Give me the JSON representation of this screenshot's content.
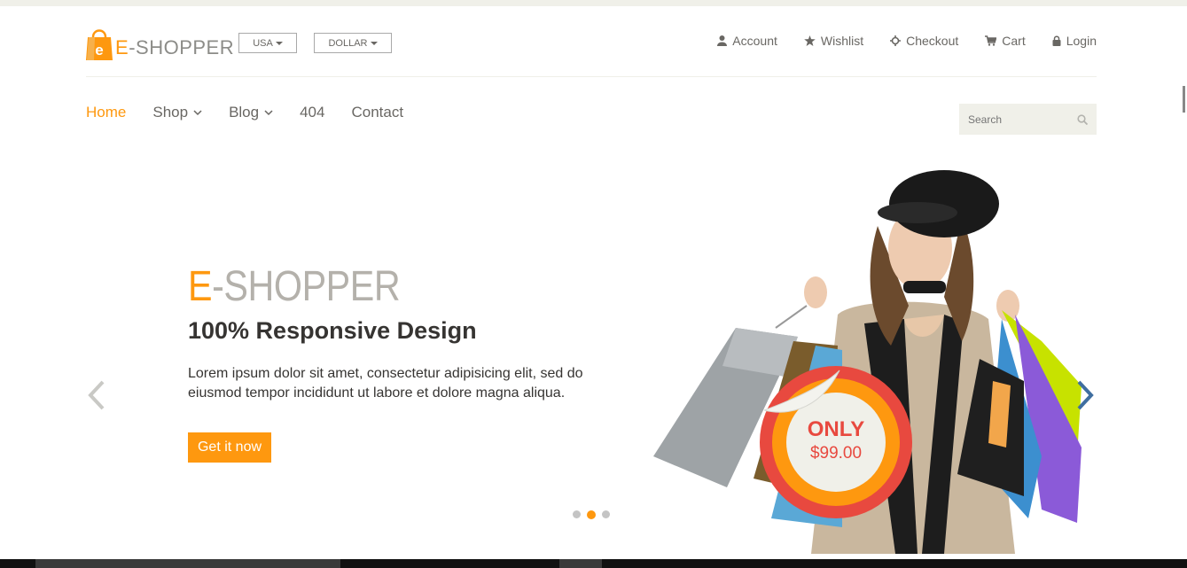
{
  "header": {
    "logo_text_accent": "E",
    "logo_text_rest": "-SHOPPER",
    "country": "USA",
    "currency": "DOLLAR",
    "account_links": [
      "Account",
      "Wishlist",
      "Checkout",
      "Cart",
      "Login"
    ]
  },
  "nav": {
    "items": [
      "Home",
      "Shop",
      "Blog",
      "404",
      "Contact"
    ],
    "active": "Home"
  },
  "search": {
    "placeholder": "Search"
  },
  "slider": {
    "title_accent": "E",
    "title_rest": "-SHOPPER",
    "subtitle": "100% Responsive Design",
    "description": "Lorem ipsum dolor sit amet, consectetur adipisicing elit, sed do eiusmod tempor incididunt ut labore et dolore magna aliqua.",
    "cta": "Get it now",
    "badge_label": "ONLY",
    "badge_price": "$99.00",
    "dots_total": 3,
    "active_dot": 2
  },
  "colors": {
    "brand": "#fe980f",
    "text": "#696763",
    "badge_red": "#e8493f",
    "light_bg": "#f0f0e9"
  },
  "icons": [
    "user-icon",
    "star-icon",
    "crosshair-icon",
    "cart-icon",
    "lock-icon",
    "search-icon",
    "chevron-left-icon",
    "chevron-right-icon",
    "chevron-down-icon",
    "shopping-bag-icon"
  ]
}
